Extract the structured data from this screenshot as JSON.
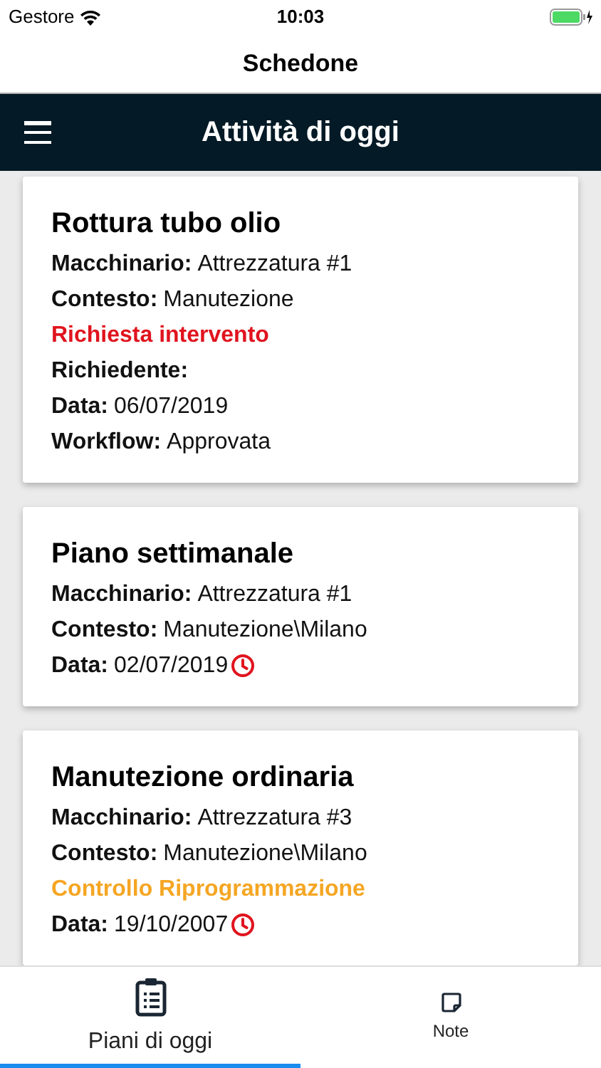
{
  "status_bar": {
    "carrier": "Gestore",
    "time": "10:03"
  },
  "nav_title": "Schedone",
  "toolbar": {
    "title": "Attività di oggi"
  },
  "cards": [
    {
      "title": "Rottura tubo olio",
      "lines": [
        {
          "kind": "field",
          "label": "Macchinario:",
          "value": "Attrezzatura #1",
          "overdue": false
        },
        {
          "kind": "field",
          "label": "Contesto:",
          "value": "Manutezione",
          "overdue": false
        },
        {
          "kind": "status",
          "text": "Richiesta intervento",
          "color": "#e0141e"
        },
        {
          "kind": "field",
          "label": "Richiedente:",
          "overdue": false
        },
        {
          "kind": "field",
          "label": "Data:",
          "value": "06/07/2019",
          "overdue": false
        },
        {
          "kind": "field",
          "label": "Workflow:",
          "value": "Approvata",
          "overdue": false
        }
      ]
    },
    {
      "title": "Piano settimanale",
      "lines": [
        {
          "kind": "field",
          "label": "Macchinario:",
          "value": "Attrezzatura #1",
          "overdue": false
        },
        {
          "kind": "field",
          "label": "Contesto:",
          "value": "Manutezione\\Milano",
          "overdue": false
        },
        {
          "kind": "field",
          "label": "Data:",
          "value": "02/07/2019",
          "overdue": true
        }
      ]
    },
    {
      "title": "Manutezione ordinaria",
      "lines": [
        {
          "kind": "field",
          "label": "Macchinario:",
          "value": "Attrezzatura #3",
          "overdue": false
        },
        {
          "kind": "field",
          "label": "Contesto:",
          "value": "Manutezione\\Milano",
          "overdue": false
        },
        {
          "kind": "status",
          "text": "Controllo Riprogrammazione",
          "color": "#f5a623"
        },
        {
          "kind": "field",
          "label": "Data:",
          "value": "19/10/2007",
          "overdue": true
        }
      ]
    }
  ],
  "tabs": [
    {
      "label": "Piani di oggi",
      "selected": true
    },
    {
      "label": "Note",
      "selected": false
    }
  ]
}
